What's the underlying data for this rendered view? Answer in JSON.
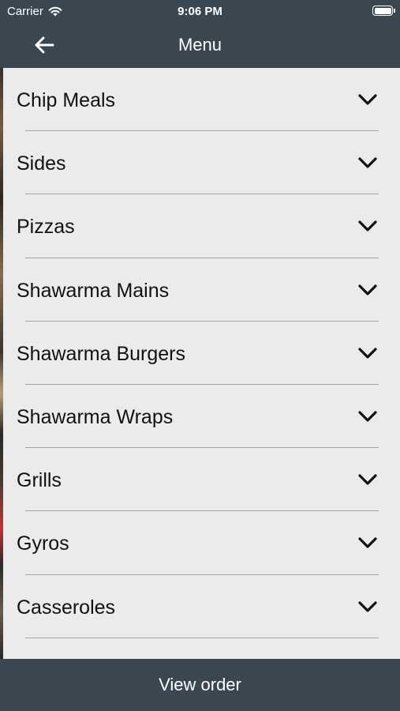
{
  "status_bar": {
    "carrier": "Carrier",
    "time": "9:06 PM",
    "wifi_icon": "wifi-icon",
    "battery_icon": "battery-icon"
  },
  "nav": {
    "title": "Menu",
    "back_icon": "arrow-left-icon"
  },
  "menu": {
    "chevron_icon": "chevron-down-icon",
    "items": [
      {
        "label": "Chip Meals"
      },
      {
        "label": "Sides"
      },
      {
        "label": "Pizzas"
      },
      {
        "label": "Shawarma Mains"
      },
      {
        "label": "Shawarma Burgers"
      },
      {
        "label": "Shawarma Wraps"
      },
      {
        "label": "Grills"
      },
      {
        "label": "Gyros"
      },
      {
        "label": "Casseroles"
      }
    ]
  },
  "footer": {
    "view_order_label": "View order"
  },
  "colors": {
    "bar_background": "#3b4750",
    "panel_background": "#ebebeb",
    "divider": "#a8a8a8",
    "text_dark": "#111111",
    "text_light": "#ffffff"
  }
}
